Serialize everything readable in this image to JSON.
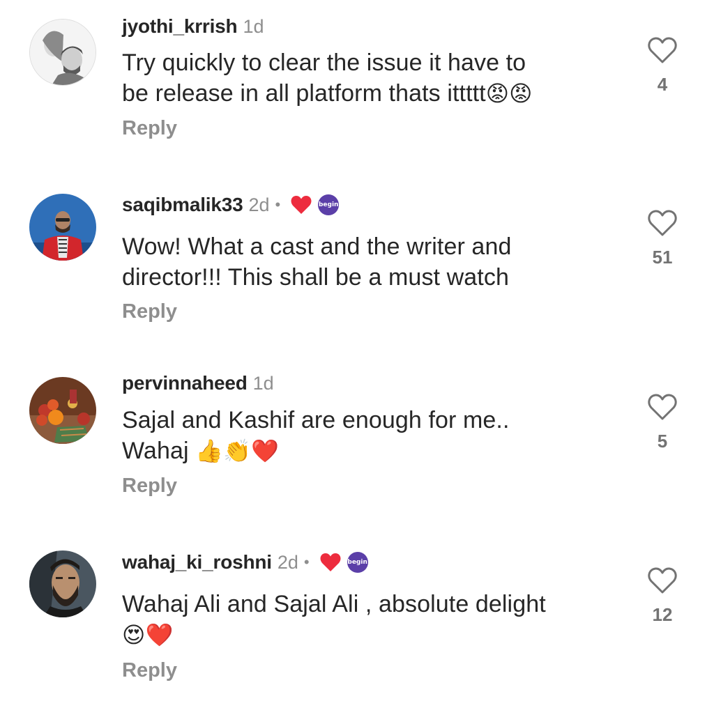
{
  "comments": [
    {
      "username": "jyothi_krrish",
      "time": "1d",
      "line1": "Try quickly to clear the issue it have to",
      "line2": "be release in all platform thats ittttt",
      "emojis": "😡😡",
      "reply": "Reply",
      "likes": "4",
      "avatar_icon": "couple-sketch-avatar"
    },
    {
      "username": "saqibmalik33",
      "time": "2d",
      "separator": "•",
      "creator_heart": "heart-icon",
      "creator_badge": "begin",
      "line1": "Wow! What a cast and the writer and",
      "line2": "director!!! This shall be a must watch",
      "reply": "Reply",
      "likes": "51",
      "avatar_icon": "man-blue-background-avatar"
    },
    {
      "username": "pervinnaheed",
      "time": "1d",
      "line1": "Sajal and Kashif are enough for me..",
      "line2": "Wahaj",
      "emojis": "👍👏❤️",
      "reply": "Reply",
      "likes": "5",
      "avatar_icon": "fruits-avatar"
    },
    {
      "username": "wahaj_ki_roshni",
      "time": "2d",
      "separator": "•",
      "creator_heart": "heart-icon",
      "creator_badge": "begin",
      "line1": "Wahaj Ali and Sajal Ali , absolute delight",
      "emojis": "😍❤️",
      "reply": "Reply",
      "likes": "12",
      "avatar_icon": "bearded-man-avatar"
    }
  ],
  "colors": {
    "username": "#262626",
    "secondary": "#8e8e8e",
    "heart_red": "#ed2c3e",
    "badge_purple": "#5b3fa8"
  }
}
